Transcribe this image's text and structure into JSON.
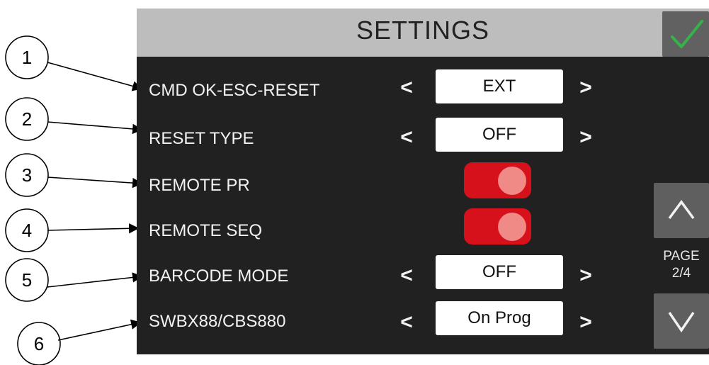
{
  "header": {
    "title": "SETTINGS",
    "confirm_icon": "checkmark-icon",
    "accent": "#35b34a"
  },
  "rows": [
    {
      "label": "CMD OK-ESC-RESET",
      "control": "selector",
      "value": "EXT",
      "prev": "<",
      "next": ">"
    },
    {
      "label": "RESET TYPE",
      "control": "selector",
      "value": "OFF",
      "prev": "<",
      "next": ">"
    },
    {
      "label": "REMOTE PR",
      "control": "toggle",
      "state": "on"
    },
    {
      "label": "REMOTE SEQ",
      "control": "toggle",
      "state": "on"
    },
    {
      "label": "BARCODE MODE",
      "control": "selector",
      "value": "OFF",
      "prev": "<",
      "next": ">"
    },
    {
      "label": "SWBX88/CBS880",
      "control": "selector",
      "value": "On Prog",
      "prev": "<",
      "next": ">"
    }
  ],
  "pager": {
    "page_label": "PAGE",
    "page_value": "2/4",
    "current_page": 2,
    "total_pages": 4,
    "up_icon": "chevron-up-icon",
    "down_icon": "chevron-down-icon"
  },
  "callouts": [
    "1",
    "2",
    "3",
    "4",
    "5",
    "6"
  ],
  "colors": {
    "background": "#212121",
    "header": "#bdbdbd",
    "toggle_on": "#d6111b",
    "knob": "#f08a86",
    "nav_button": "#5f5f5f"
  }
}
